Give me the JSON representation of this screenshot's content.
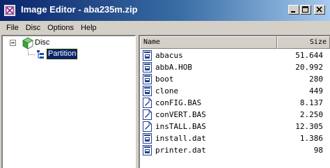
{
  "window": {
    "title": "Image Editor - aba235m.zip",
    "app_icon": "image-editor-icon"
  },
  "menu": [
    "File",
    "Disc",
    "Options",
    "Help"
  ],
  "tree": {
    "root_label": "Disc",
    "root_icon": "disc-icon",
    "child_label": "Partition",
    "child_icon": "partition-icon",
    "selected": "Partition"
  },
  "list": {
    "columns": {
      "name": "Name",
      "size": "Size"
    },
    "rows": [
      {
        "name": "abacus",
        "size": "51.644",
        "icon": "binary-file-icon"
      },
      {
        "name": "abbA.HOB",
        "size": "20.992",
        "icon": "binary-file-icon"
      },
      {
        "name": "boot",
        "size": "280",
        "icon": "binary-file-icon"
      },
      {
        "name": "clone",
        "size": "449",
        "icon": "binary-file-icon"
      },
      {
        "name": "conFIG.BAS",
        "size": "8.137",
        "icon": "basic-file-icon"
      },
      {
        "name": "conVERT.BAS",
        "size": "2.250",
        "icon": "basic-file-icon"
      },
      {
        "name": "insTALL.BAS",
        "size": "12.305",
        "icon": "basic-file-icon"
      },
      {
        "name": "install.dat",
        "size": "1.386",
        "icon": "binary-file-icon"
      },
      {
        "name": "printer.dat",
        "size": "98",
        "icon": "binary-file-icon"
      }
    ]
  }
}
